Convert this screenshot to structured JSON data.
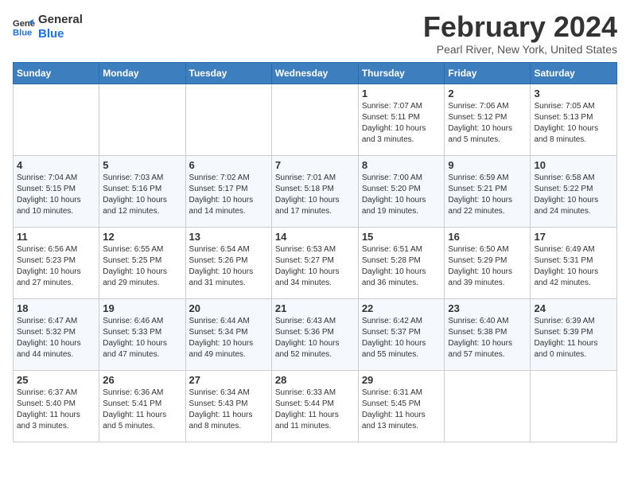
{
  "header": {
    "logo_line1": "General",
    "logo_line2": "Blue",
    "month_title": "February 2024",
    "location": "Pearl River, New York, United States"
  },
  "days_of_week": [
    "Sunday",
    "Monday",
    "Tuesday",
    "Wednesday",
    "Thursday",
    "Friday",
    "Saturday"
  ],
  "weeks": [
    [
      {
        "day": "",
        "info": ""
      },
      {
        "day": "",
        "info": ""
      },
      {
        "day": "",
        "info": ""
      },
      {
        "day": "",
        "info": ""
      },
      {
        "day": "1",
        "info": "Sunrise: 7:07 AM\nSunset: 5:11 PM\nDaylight: 10 hours\nand 3 minutes."
      },
      {
        "day": "2",
        "info": "Sunrise: 7:06 AM\nSunset: 5:12 PM\nDaylight: 10 hours\nand 5 minutes."
      },
      {
        "day": "3",
        "info": "Sunrise: 7:05 AM\nSunset: 5:13 PM\nDaylight: 10 hours\nand 8 minutes."
      }
    ],
    [
      {
        "day": "4",
        "info": "Sunrise: 7:04 AM\nSunset: 5:15 PM\nDaylight: 10 hours\nand 10 minutes."
      },
      {
        "day": "5",
        "info": "Sunrise: 7:03 AM\nSunset: 5:16 PM\nDaylight: 10 hours\nand 12 minutes."
      },
      {
        "day": "6",
        "info": "Sunrise: 7:02 AM\nSunset: 5:17 PM\nDaylight: 10 hours\nand 14 minutes."
      },
      {
        "day": "7",
        "info": "Sunrise: 7:01 AM\nSunset: 5:18 PM\nDaylight: 10 hours\nand 17 minutes."
      },
      {
        "day": "8",
        "info": "Sunrise: 7:00 AM\nSunset: 5:20 PM\nDaylight: 10 hours\nand 19 minutes."
      },
      {
        "day": "9",
        "info": "Sunrise: 6:59 AM\nSunset: 5:21 PM\nDaylight: 10 hours\nand 22 minutes."
      },
      {
        "day": "10",
        "info": "Sunrise: 6:58 AM\nSunset: 5:22 PM\nDaylight: 10 hours\nand 24 minutes."
      }
    ],
    [
      {
        "day": "11",
        "info": "Sunrise: 6:56 AM\nSunset: 5:23 PM\nDaylight: 10 hours\nand 27 minutes."
      },
      {
        "day": "12",
        "info": "Sunrise: 6:55 AM\nSunset: 5:25 PM\nDaylight: 10 hours\nand 29 minutes."
      },
      {
        "day": "13",
        "info": "Sunrise: 6:54 AM\nSunset: 5:26 PM\nDaylight: 10 hours\nand 31 minutes."
      },
      {
        "day": "14",
        "info": "Sunrise: 6:53 AM\nSunset: 5:27 PM\nDaylight: 10 hours\nand 34 minutes."
      },
      {
        "day": "15",
        "info": "Sunrise: 6:51 AM\nSunset: 5:28 PM\nDaylight: 10 hours\nand 36 minutes."
      },
      {
        "day": "16",
        "info": "Sunrise: 6:50 AM\nSunset: 5:29 PM\nDaylight: 10 hours\nand 39 minutes."
      },
      {
        "day": "17",
        "info": "Sunrise: 6:49 AM\nSunset: 5:31 PM\nDaylight: 10 hours\nand 42 minutes."
      }
    ],
    [
      {
        "day": "18",
        "info": "Sunrise: 6:47 AM\nSunset: 5:32 PM\nDaylight: 10 hours\nand 44 minutes."
      },
      {
        "day": "19",
        "info": "Sunrise: 6:46 AM\nSunset: 5:33 PM\nDaylight: 10 hours\nand 47 minutes."
      },
      {
        "day": "20",
        "info": "Sunrise: 6:44 AM\nSunset: 5:34 PM\nDaylight: 10 hours\nand 49 minutes."
      },
      {
        "day": "21",
        "info": "Sunrise: 6:43 AM\nSunset: 5:36 PM\nDaylight: 10 hours\nand 52 minutes."
      },
      {
        "day": "22",
        "info": "Sunrise: 6:42 AM\nSunset: 5:37 PM\nDaylight: 10 hours\nand 55 minutes."
      },
      {
        "day": "23",
        "info": "Sunrise: 6:40 AM\nSunset: 5:38 PM\nDaylight: 10 hours\nand 57 minutes."
      },
      {
        "day": "24",
        "info": "Sunrise: 6:39 AM\nSunset: 5:39 PM\nDaylight: 11 hours\nand 0 minutes."
      }
    ],
    [
      {
        "day": "25",
        "info": "Sunrise: 6:37 AM\nSunset: 5:40 PM\nDaylight: 11 hours\nand 3 minutes."
      },
      {
        "day": "26",
        "info": "Sunrise: 6:36 AM\nSunset: 5:41 PM\nDaylight: 11 hours\nand 5 minutes."
      },
      {
        "day": "27",
        "info": "Sunrise: 6:34 AM\nSunset: 5:43 PM\nDaylight: 11 hours\nand 8 minutes."
      },
      {
        "day": "28",
        "info": "Sunrise: 6:33 AM\nSunset: 5:44 PM\nDaylight: 11 hours\nand 11 minutes."
      },
      {
        "day": "29",
        "info": "Sunrise: 6:31 AM\nSunset: 5:45 PM\nDaylight: 11 hours\nand 13 minutes."
      },
      {
        "day": "",
        "info": ""
      },
      {
        "day": "",
        "info": ""
      }
    ]
  ]
}
